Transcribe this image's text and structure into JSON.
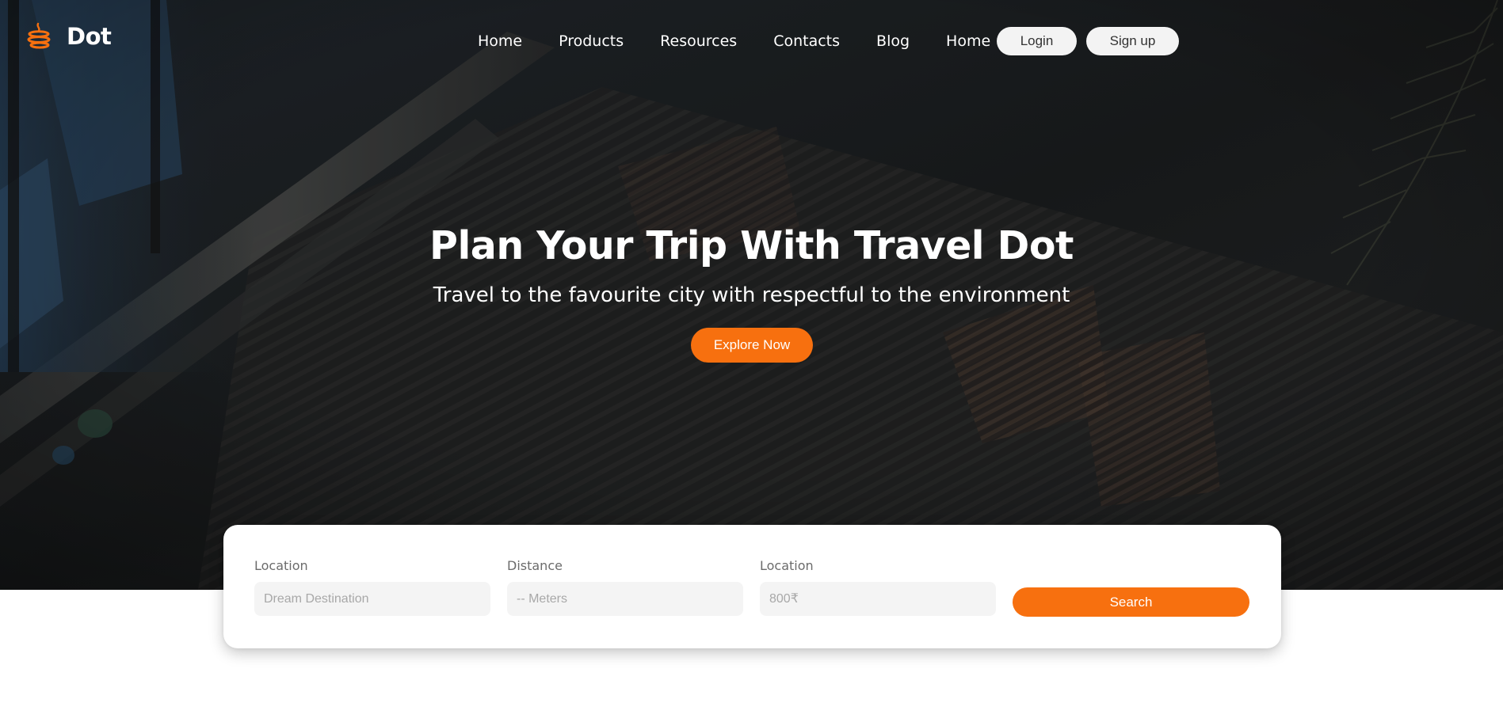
{
  "brand": {
    "name": "Dot",
    "logo_icon": "stacked-rings-icon",
    "accent_color": "#f7700f"
  },
  "nav": {
    "items": [
      {
        "label": "Home"
      },
      {
        "label": "Products"
      },
      {
        "label": "Resources"
      },
      {
        "label": "Contacts"
      },
      {
        "label": "Blog"
      },
      {
        "label": "Home"
      }
    ],
    "login_label": "Login",
    "signup_label": "Sign up"
  },
  "hero": {
    "title": "Plan Your Trip With Travel Dot",
    "subtitle": "Travel to the favourite city with respectful to the environment",
    "cta_label": "Explore Now"
  },
  "search": {
    "fields": [
      {
        "label": "Location",
        "placeholder": "Dream Destination",
        "value": ""
      },
      {
        "label": "Distance",
        "placeholder": "-- Meters",
        "value": ""
      },
      {
        "label": "Location",
        "placeholder": "800₹",
        "value": ""
      }
    ],
    "button_label": "Search"
  }
}
